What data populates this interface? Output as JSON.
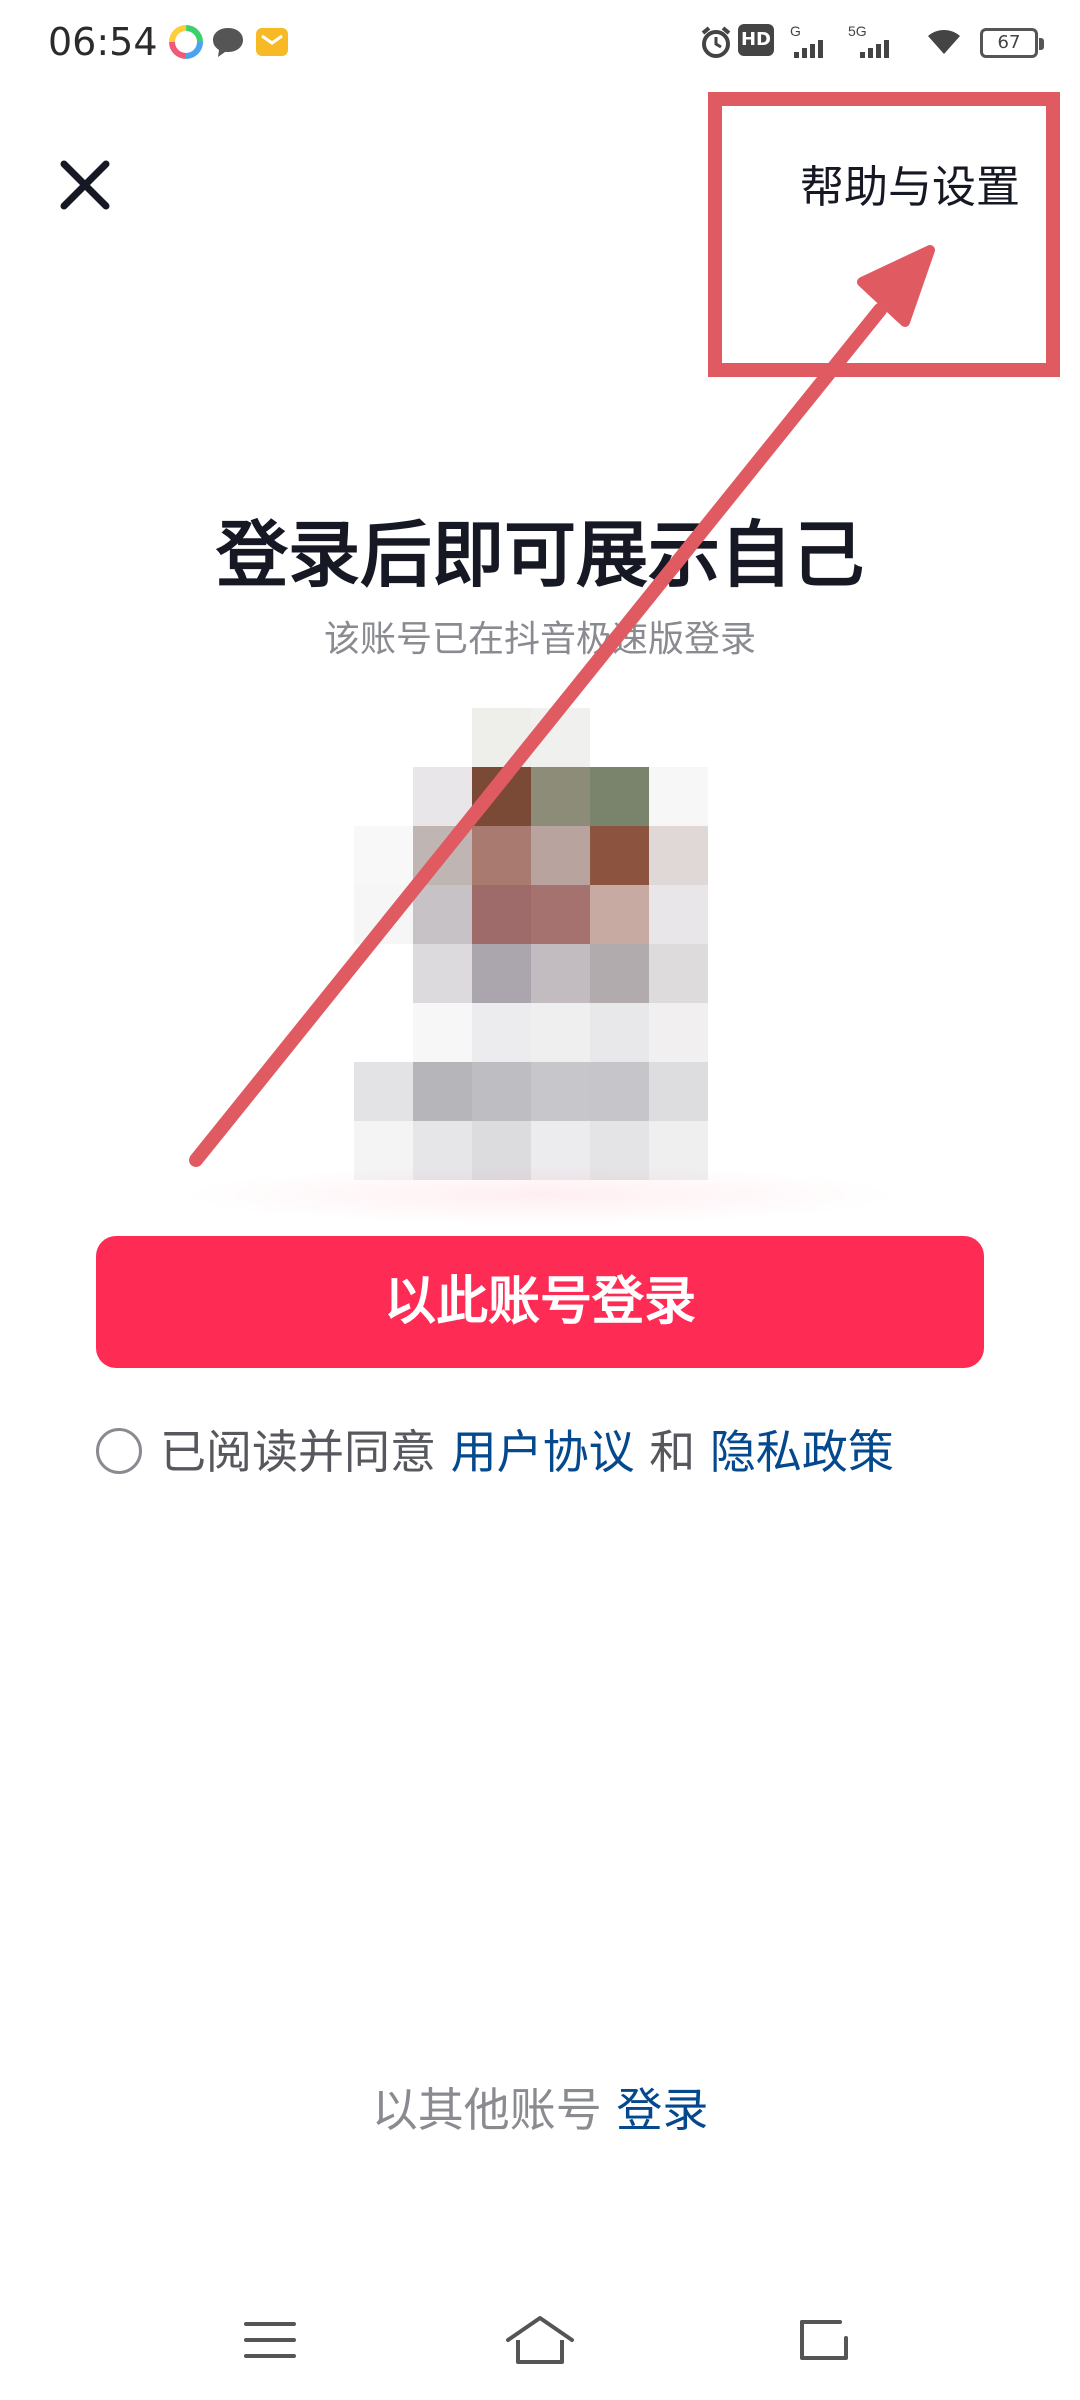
{
  "status_bar": {
    "time": "06:54",
    "battery": "67",
    "network_left": "HD",
    "network_mid": "G",
    "network_right": "5G",
    "icons": [
      "notification-app-icon",
      "chat-bubble-icon",
      "mail-icon",
      "alarm-icon",
      "hd-icon",
      "signal-icon",
      "wifi-icon",
      "battery-icon"
    ]
  },
  "header": {
    "close_icon": "close-icon",
    "help_settings_label": "帮助与设置"
  },
  "main": {
    "headline": "登录后即可展示自己",
    "subline": "该账号已在抖音极速版登录",
    "login_button_label": "以此账号登录"
  },
  "agreement": {
    "prefix": "已阅读并同意",
    "user_agreement": "用户协议",
    "and": "和",
    "privacy_policy": "隐私政策"
  },
  "footer": {
    "other_account_label": "以其他账号",
    "login_link": "登录"
  },
  "nav_bar": {
    "icons": [
      "menu-icon",
      "home-icon",
      "back-icon"
    ]
  },
  "colors": {
    "accent": "#fe2c55",
    "link": "#04498d",
    "annotation": "#e05a62"
  }
}
